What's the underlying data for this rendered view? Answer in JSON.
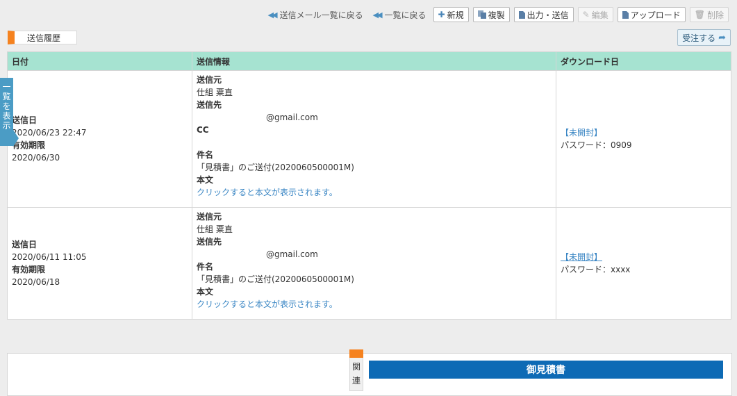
{
  "toolbar": {
    "back_to_sent_list": "送信メール一覧に戻る",
    "back_to_list": "一覧に戻る",
    "new": "新規",
    "duplicate": "複製",
    "output_send": "出力・送信",
    "edit": "編集",
    "upload": "アップロード",
    "delete": "削除"
  },
  "section_title": "送信履歴",
  "order_button": "受注する",
  "side_tab": [
    "一",
    "覧",
    "を",
    "表",
    "示"
  ],
  "table": {
    "headers": {
      "date": "日付",
      "info": "送信情報",
      "download": "ダウンロード日"
    },
    "labels": {
      "sent_date": "送信日",
      "expiry": "有効期限",
      "from": "送信元",
      "to": "送信先",
      "cc": "CC",
      "subject": "件名",
      "body": "本文"
    },
    "rows": [
      {
        "sent_date": "2020/06/23 22:47",
        "expiry": "2020/06/30",
        "from": "仕組 粟直",
        "to": "@gmail.com",
        "cc": "",
        "subject": "「見積書」のご送付(2020060500001M)",
        "body_link": "クリックすると本文が表示されます。",
        "status": "【未開封】",
        "password": "パスワード：0909"
      },
      {
        "sent_date": "2020/06/11 11:05",
        "expiry": "2020/06/18",
        "from": "仕組 粟直",
        "to": "@gmail.com",
        "subject": "「見積書」のご送付(2020060500001M)",
        "body_link": "クリックすると本文が表示されます。",
        "status": "【未開封】",
        "password": "パスワード：xxxx"
      }
    ]
  },
  "related_tab": [
    "関",
    "連"
  ],
  "estimate_title": "御見積書"
}
